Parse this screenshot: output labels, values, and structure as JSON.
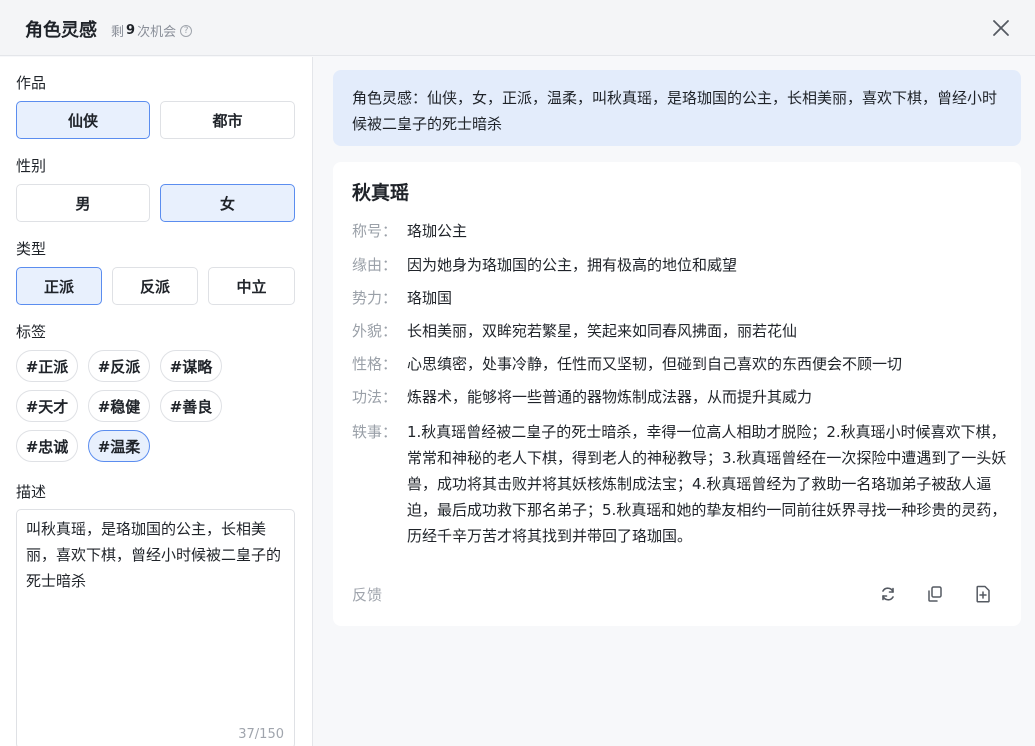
{
  "header": {
    "title": "角色灵感",
    "quota_prefix": "剩",
    "quota_count": "9",
    "quota_suffix": "次机会",
    "help_glyph": "?"
  },
  "left": {
    "works": {
      "label": "作品",
      "options": [
        "仙侠",
        "都市"
      ],
      "selected": "仙侠"
    },
    "gender": {
      "label": "性别",
      "options": [
        "男",
        "女"
      ],
      "selected": "女"
    },
    "type": {
      "label": "类型",
      "options": [
        "正派",
        "反派",
        "中立"
      ],
      "selected": "正派"
    },
    "tags": {
      "label": "标签",
      "items": [
        "#正派",
        "#反派",
        "#谋略",
        "#天才",
        "#稳健",
        "#善良",
        "#忠诚",
        "#温柔"
      ],
      "selected": "#温柔"
    },
    "description": {
      "label": "描述",
      "value": "叫秋真瑶，是珞珈国的公主，长相美丽，喜欢下棋，曾经小时候被二皇子的死士暗杀",
      "counter": "37/150"
    }
  },
  "prompt": "角色灵感：仙侠，女，正派，温柔，叫秋真瑶，是珞珈国的公主，长相美丽，喜欢下棋，曾经小时候被二皇子的死士暗杀",
  "result": {
    "name": "秋真瑶",
    "fields": [
      {
        "key": "称号：",
        "value": "珞珈公主"
      },
      {
        "key": "缘由：",
        "value": "因为她身为珞珈国的公主，拥有极高的地位和威望"
      },
      {
        "key": "势力：",
        "value": "珞珈国"
      },
      {
        "key": "外貌：",
        "value": "长相美丽，双眸宛若繁星，笑起来如同春风拂面，丽若花仙"
      },
      {
        "key": "性格：",
        "value": "心思缜密，处事冷静，任性而又坚韧，但碰到自己喜欢的东西便会不顾一切"
      },
      {
        "key": "功法：",
        "value": "炼器术，能够将一些普通的器物炼制成法器，从而提升其威力"
      },
      {
        "key": "轶事：",
        "value": "1.秋真瑶曾经被二皇子的死士暗杀，幸得一位高人相助才脱险；2.秋真瑶小时候喜欢下棋，常常和神秘的老人下棋，得到老人的神秘教导；3.秋真瑶曾经在一次探险中遭遇到了一头妖兽，成功将其击败并将其妖核炼制成法宝；4.秋真瑶曾经为了救助一名珞珈弟子被敌人逼迫，最后成功救下那名弟子；5.秋真瑶和她的挚友相约一同前往妖界寻找一种珍贵的灵药，历经千辛万苦才将其找到并带回了珞珈国。"
      }
    ],
    "feedback": "反馈",
    "actions": [
      "refresh-icon",
      "copy-icon",
      "add-file-icon"
    ]
  },
  "colors": {
    "accent": "#5b8def",
    "selected_bg": "#e8f0fd",
    "prompt_bg": "#e3ecfb"
  }
}
